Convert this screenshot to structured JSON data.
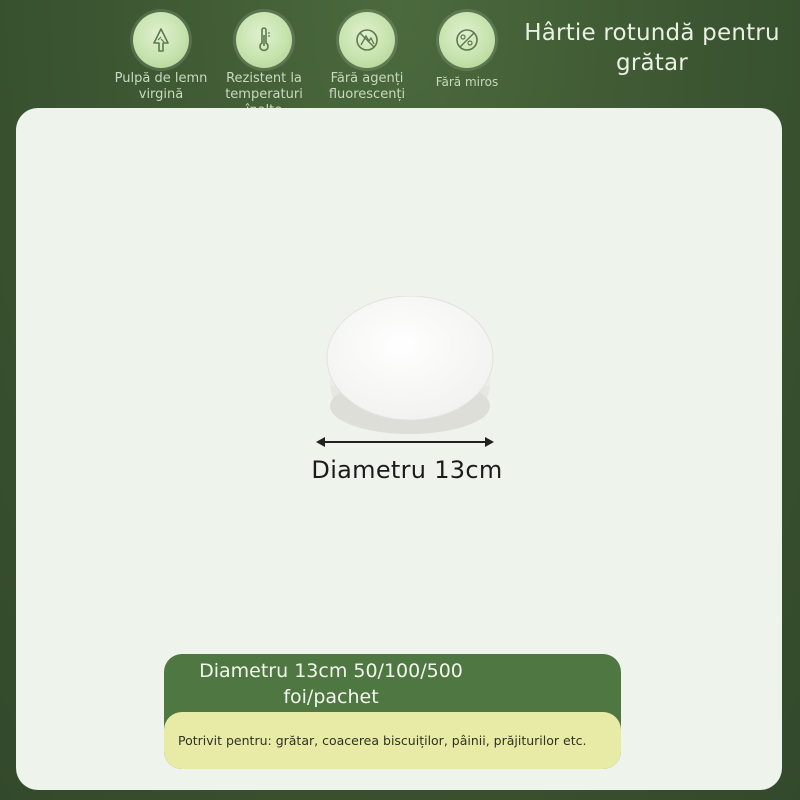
{
  "features": [
    {
      "icon": "tree-icon",
      "label": "Pulpă de lemn virgină"
    },
    {
      "icon": "thermometer-icon",
      "label": "Rezistent la temperaturi înalte"
    },
    {
      "icon": "no-fluorescent-icon",
      "label": "Fără agenți fluorescenți"
    },
    {
      "icon": "no-odor-icon",
      "label": "Fără miros"
    }
  ],
  "title": "Hârtie rotundă pentru grătar",
  "measurement": "Diametru 13cm",
  "info": {
    "title": "Diametru 13cm 50/100/500 foi/pachet",
    "usage": "Potrivit pentru: grătar, coacerea biscuiților, pâinii, prăjiturilor etc."
  },
  "colors": {
    "background": "#3f5a34",
    "panel": "#eef3ec",
    "badge": "#c6e3ad",
    "info_box": "#4f7742",
    "usage_box": "#e8eba6"
  }
}
